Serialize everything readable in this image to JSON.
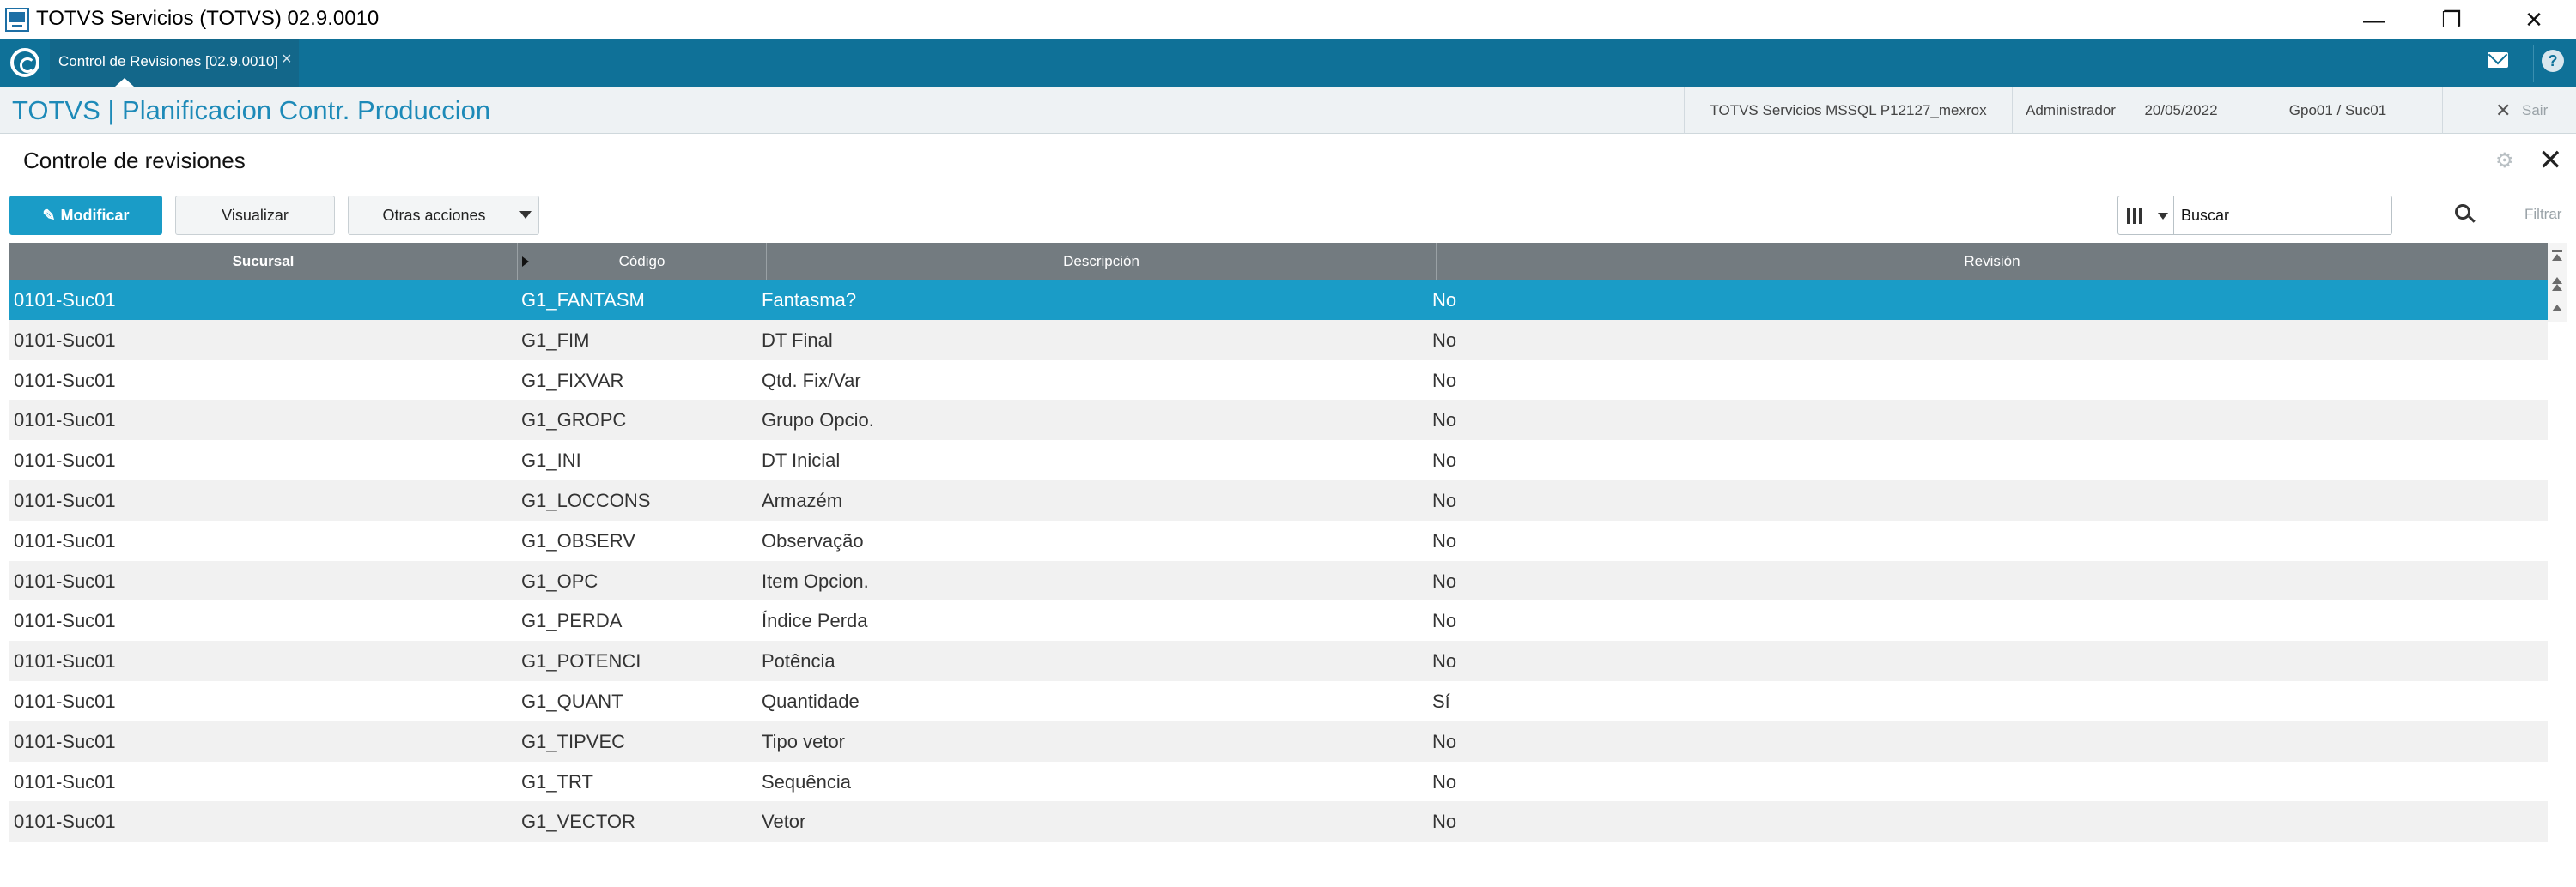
{
  "window": {
    "title": "TOTVS Servicios (TOTVS) 02.9.0010",
    "minimize_glyph": "—",
    "restore_glyph": "❐",
    "close_glyph": "✕"
  },
  "tabs": [
    {
      "label": "Control de Revisiones [02.9.0010]",
      "close": "×"
    }
  ],
  "header": {
    "module_title": "TOTVS | Planificacion Contr. Produccion",
    "environment": "TOTVS Servicios MSSQL P12127_mexrox",
    "user": "Administrador",
    "date": "20/05/2022",
    "branch": "Gpo01 / Suc01",
    "exit_label": "Sair"
  },
  "page": {
    "title": "Controle de revisiones"
  },
  "toolbar": {
    "modify_label": "Modificar",
    "view_label": "Visualizar",
    "other_label": "Otras acciones",
    "search_value": "Buscar",
    "filter_label": "Filtrar"
  },
  "grid": {
    "columns": [
      "Sucursal",
      "Código",
      "Descripción",
      "Revisión"
    ],
    "rows": [
      [
        "0101-Suc01",
        "G1_FANTASM",
        "Fantasma?",
        "No"
      ],
      [
        "0101-Suc01",
        "G1_FIM",
        "DT Final",
        "No"
      ],
      [
        "0101-Suc01",
        "G1_FIXVAR",
        "Qtd. Fix/Var",
        "No"
      ],
      [
        "0101-Suc01",
        "G1_GROPC",
        "Grupo Opcio.",
        "No"
      ],
      [
        "0101-Suc01",
        "G1_INI",
        "DT Inicial",
        "No"
      ],
      [
        "0101-Suc01",
        "G1_LOCCONS",
        "Armazém",
        "No"
      ],
      [
        "0101-Suc01",
        "G1_OBSERV",
        "Observação",
        "No"
      ],
      [
        "0101-Suc01",
        "G1_OPC",
        "Item Opcion.",
        "No"
      ],
      [
        "0101-Suc01",
        "G1_PERDA",
        "Índice Perda",
        "No"
      ],
      [
        "0101-Suc01",
        "G1_POTENCI",
        "Potência",
        "No"
      ],
      [
        "0101-Suc01",
        "G1_QUANT",
        "Quantidade",
        "Sí"
      ],
      [
        "0101-Suc01",
        "G1_TIPVEC",
        "Tipo vetor",
        "No"
      ],
      [
        "0101-Suc01",
        "G1_TRT",
        "Sequência",
        "No"
      ],
      [
        "0101-Suc01",
        "G1_VECTOR",
        "Vetor",
        "No"
      ]
    ],
    "selected_row": 0
  },
  "colors": {
    "accent": "#1a9cc7",
    "tabbar": "#0f7198",
    "module_title": "#1d8ab8",
    "grid_header": "#737b80"
  }
}
